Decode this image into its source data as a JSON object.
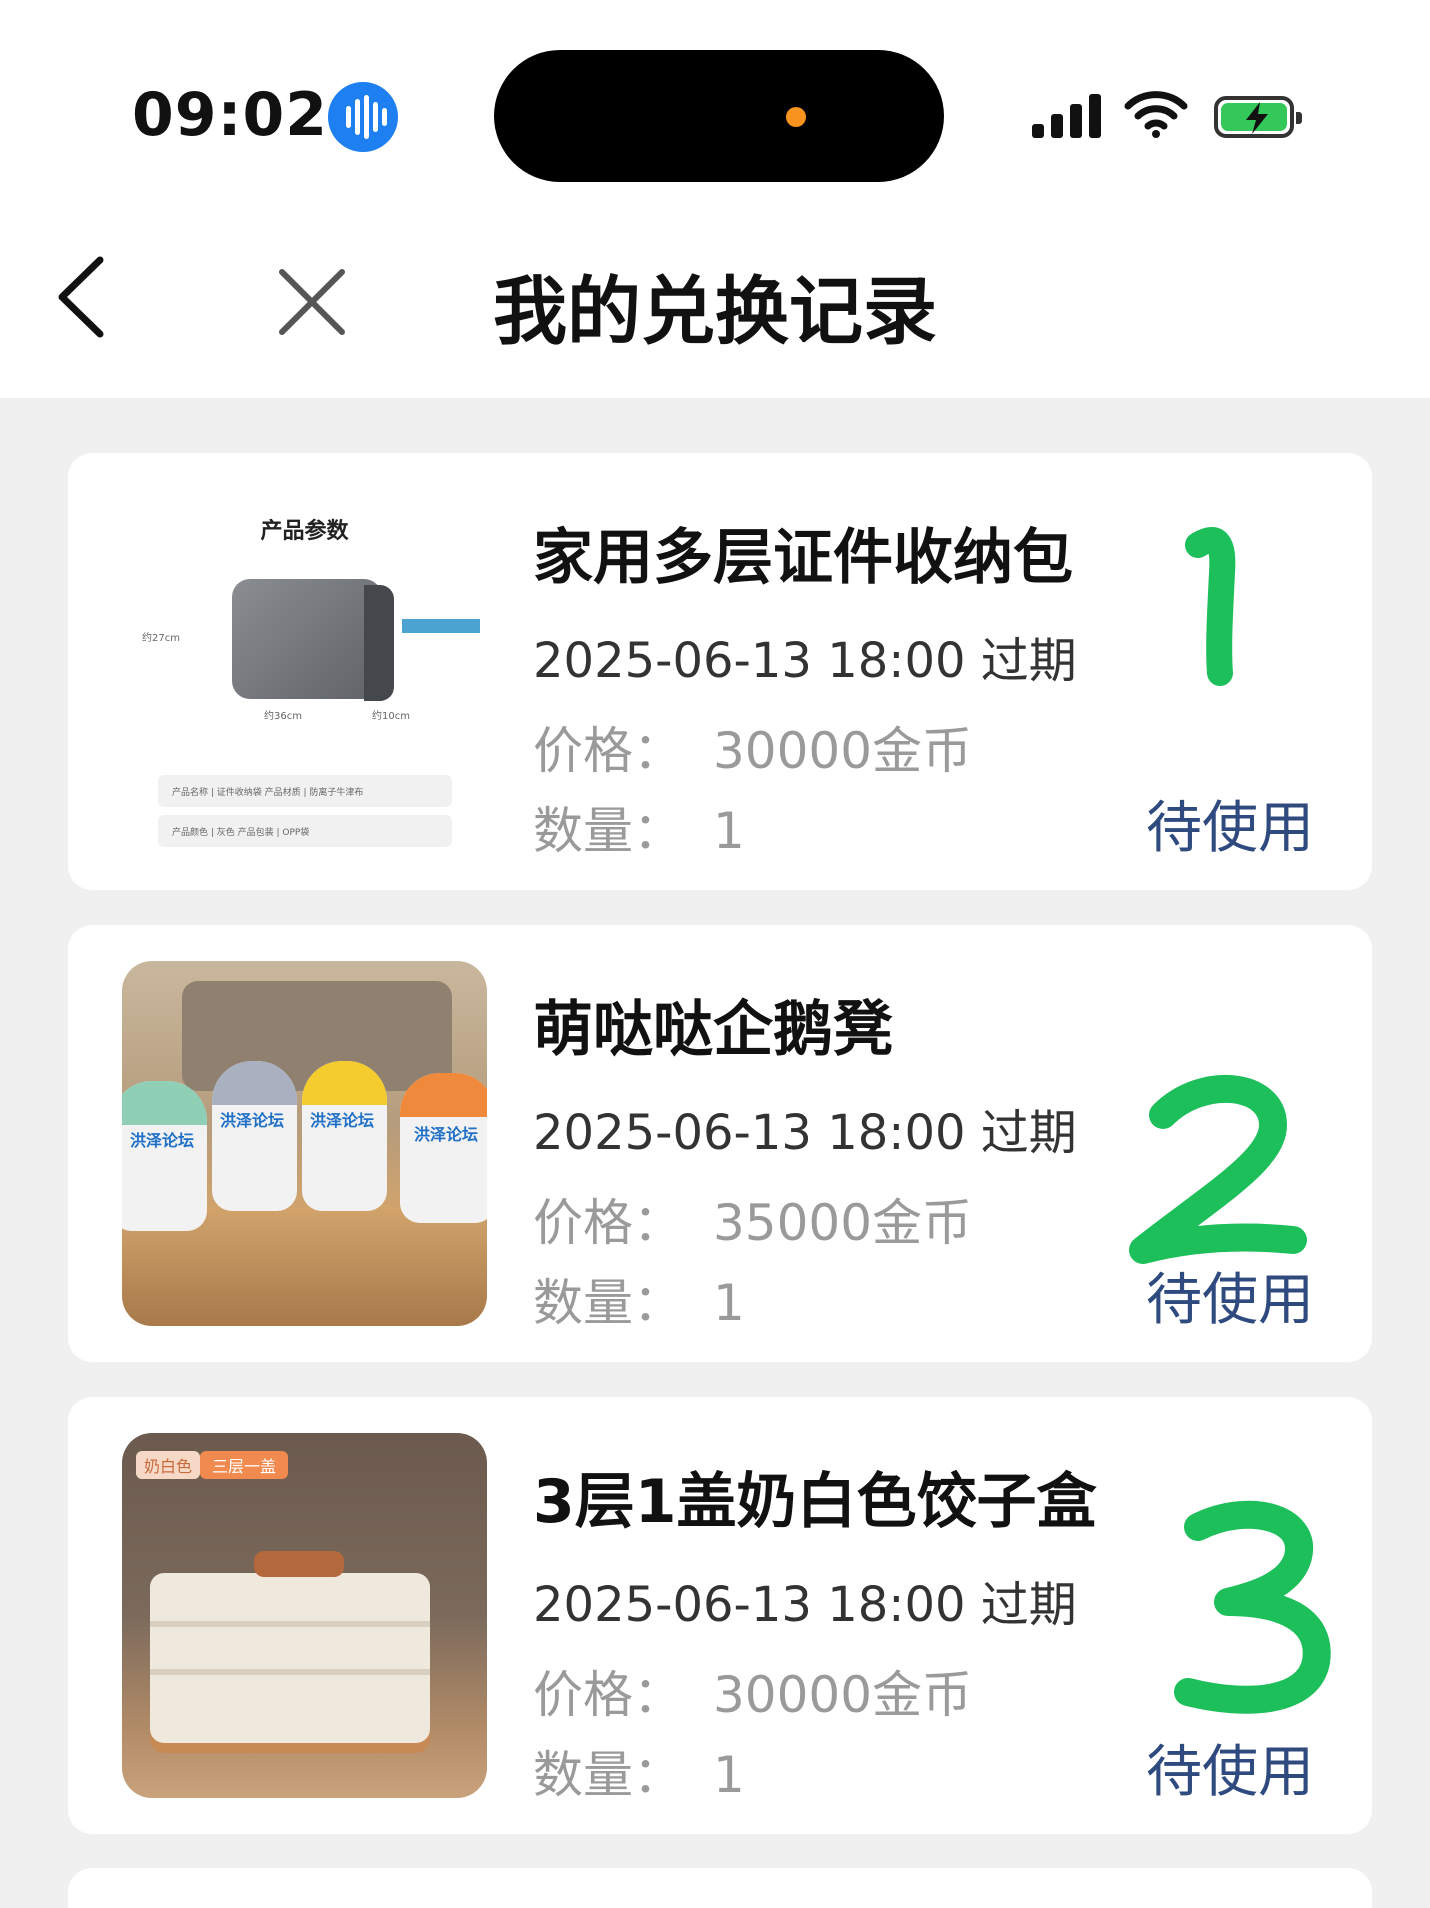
{
  "status_bar": {
    "time": "09:02"
  },
  "nav": {
    "title": "我的兑换记录"
  },
  "labels": {
    "expire_suffix": "过期",
    "price_label": "价格：",
    "qty_label": "数量："
  },
  "records": [
    {
      "name": "家用多层证件收纳包",
      "expire": "2025-06-13 18:00 过期",
      "price_label": "价格：",
      "price": "30000金币",
      "qty_label": "数量：",
      "qty": "1",
      "status": "待使用",
      "thumb": {
        "heading": "产品参数",
        "size_h": "约27cm",
        "size_w": "约36cm",
        "size_d": "约10cm",
        "row1": "产品名称 | 证件收纳袋      产品材质 | 防离子牛津布",
        "row2": "产品颜色 | 灰色            产品包装 | OPP袋"
      }
    },
    {
      "name": "萌哒哒企鹅凳",
      "expire": "2025-06-13 18:00 过期",
      "price_label": "价格：",
      "price": "35000金币",
      "qty_label": "数量：",
      "qty": "1",
      "status": "待使用",
      "thumb": {
        "tag": "洪泽论坛"
      }
    },
    {
      "name": "3层1盖奶白色饺子盒",
      "expire": "2025-06-13 18:00 过期",
      "price_label": "价格：",
      "price": "30000金币",
      "qty_label": "数量：",
      "qty": "1",
      "status": "待使用",
      "thumb": {
        "tag1": "奶白色",
        "tag2": "三层一盖"
      }
    }
  ],
  "colors": {
    "page_bg": "#f0f0f1",
    "status_text": "#2f4a7f",
    "muted_text": "#9a9a9a",
    "handwritten_marks": "#1dbf5a",
    "voice_badge": "#1d7ff0"
  }
}
